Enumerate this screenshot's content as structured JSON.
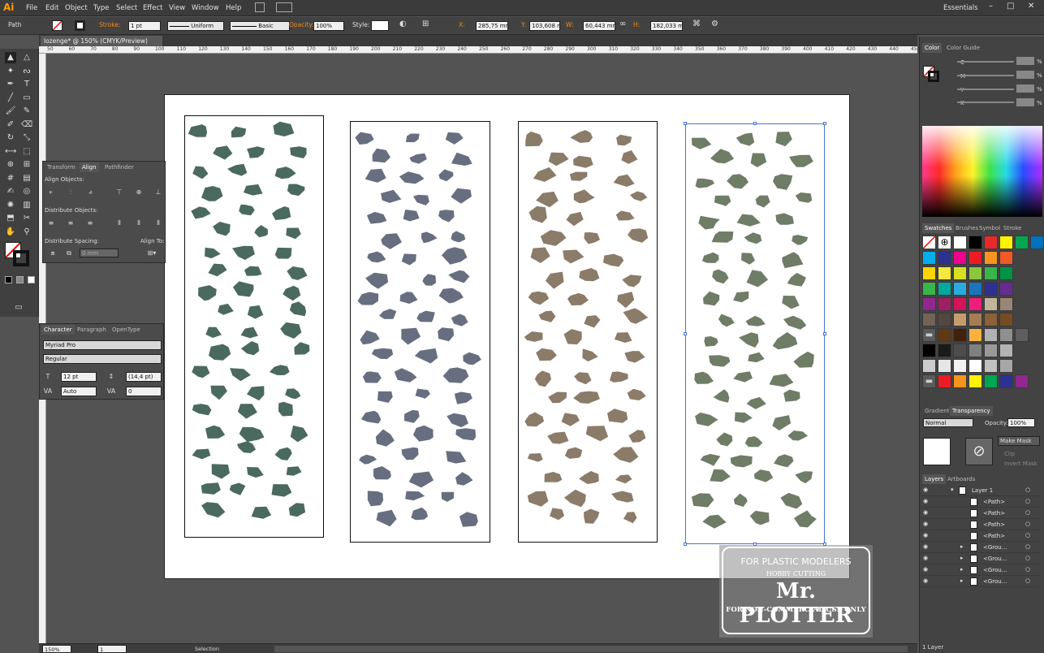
{
  "app": {
    "logo": "Ai",
    "workspace": "Essentials"
  },
  "menu": [
    "File",
    "Edit",
    "Object",
    "Type",
    "Select",
    "Effect",
    "View",
    "Window",
    "Help"
  ],
  "control": {
    "selection_label": "Path",
    "stroke_label": "Stroke:",
    "stroke_weight": "1 pt",
    "profile": "Uniform",
    "brush": "Basic",
    "opacity_label": "Opacity:",
    "opacity": "100%",
    "style_label": "Style:",
    "x_label": "X:",
    "x": "285,75 mm",
    "y_label": "Y:",
    "y": "103,608 mm",
    "w_label": "W:",
    "w": "60,443 mm",
    "h_label": "H:",
    "h": "182,033 mm"
  },
  "document": {
    "tab": "lozenge* @ 150% (CMYK/Preview)",
    "zoom": "150%",
    "artboard_num": "1",
    "status": "Selection"
  },
  "ruler_ticks": [
    "50",
    "60",
    "70",
    "80",
    "90",
    "100",
    "110",
    "120",
    "130",
    "140",
    "150",
    "160",
    "170",
    "180",
    "190",
    "200",
    "210",
    "220",
    "230",
    "240",
    "250",
    "260",
    "270",
    "280",
    "290",
    "300",
    "310",
    "320",
    "330",
    "340",
    "350",
    "360",
    "370",
    "380",
    "390",
    "400",
    "410",
    "420",
    "430",
    "440",
    "450"
  ],
  "patterns": [
    {
      "name": "pattern-1",
      "color": "#4b6a5f"
    },
    {
      "name": "pattern-2",
      "color": "#676e80"
    },
    {
      "name": "pattern-3",
      "color": "#8b7b69"
    },
    {
      "name": "pattern-4",
      "color": "#6f7c66"
    }
  ],
  "align_panel": {
    "tabs": [
      "Transform",
      "Align",
      "Pathfinder"
    ],
    "align_objects": "Align Objects:",
    "distribute_objects": "Distribute Objects:",
    "distribute_spacing": "Distribute Spacing:",
    "align_to": "Align To:",
    "spacing_value": "0 mm"
  },
  "character_panel": {
    "tabs": [
      "Character",
      "Paragraph",
      "OpenType"
    ],
    "font": "Myriad Pro",
    "style": "Regular",
    "size": "12 pt",
    "leading": "(14,4 pt)",
    "kerning": "Auto",
    "tracking": "0"
  },
  "color_panel": {
    "tabs": [
      "Color",
      "Color Guide"
    ],
    "channels": [
      {
        "label": "C",
        "unit": "%"
      },
      {
        "label": "M",
        "unit": "%"
      },
      {
        "label": "Y",
        "unit": "%"
      },
      {
        "label": "K",
        "unit": "%"
      }
    ]
  },
  "swatches_panel": {
    "tabs": [
      "Swatches",
      "Brushes",
      "Symbol",
      "Stroke"
    ],
    "colors": [
      [
        "#ffffff",
        "#000000",
        "#e8282b",
        "#fff200",
        "#00a651",
        "#0071bc"
      ],
      [
        "#00aeef",
        "#2e3192",
        "#ec008c",
        "#ed1c24",
        "#f7941d",
        "#f15a24"
      ],
      [
        "#ffd400",
        "#f4e93d",
        "#d7df23",
        "#8dc63f",
        "#39b54a",
        "#009245"
      ],
      [
        "#39b54a",
        "#00a99d",
        "#29abe2",
        "#1b75bc",
        "#2e3192",
        "#662d91"
      ],
      [
        "#92278f",
        "#9e1f63",
        "#d4145a",
        "#ed1e79",
        "#c2b59b",
        "#998675"
      ],
      [
        "#736357",
        "#534741",
        "#c69c6d",
        "#a67c52",
        "#8c6239",
        "#754c24"
      ],
      [
        "#603813",
        "#42210b",
        "#fbb040",
        "#b2b2b2",
        "#8f8f8f",
        "#5e5e5e"
      ],
      [
        "#000000",
        "#1a1a1a",
        "#4d4d4d",
        "#808080",
        "#999999",
        "#b3b3b3"
      ],
      [
        "#cccccc",
        "#e6e6e6",
        "#f2f2f2",
        "#ffffff",
        "#c1c1c1",
        "#a7a7a7"
      ],
      [
        "#ed1c24",
        "#f7941d",
        "#fff200",
        "#00a651",
        "#2e3192",
        "#92278f"
      ]
    ]
  },
  "transparency_panel": {
    "tabs": [
      "Gradient",
      "Transparency"
    ],
    "mode": "Normal",
    "opacity_label": "Opacity:",
    "opacity": "100%",
    "make_mask": "Make Mask",
    "clip": "Clip",
    "invert_mask": "Invert Mask"
  },
  "layers_panel": {
    "tabs": [
      "Layers",
      "Artboards"
    ],
    "rows": [
      "Layer 1",
      "<Path>",
      "<Path>",
      "<Path>",
      "<Path>",
      "<Grou...",
      "<Grou...",
      "<Grou...",
      "<Grou..."
    ],
    "footer": "1 Layer"
  },
  "watermark": {
    "line1": "FOR PLASTIC MODELERS",
    "line2": "HOBBY CUTTING",
    "line3": "Mr. PLOTTER",
    "line4": "FOR NON-COMMERCIAL USE ONLY"
  }
}
